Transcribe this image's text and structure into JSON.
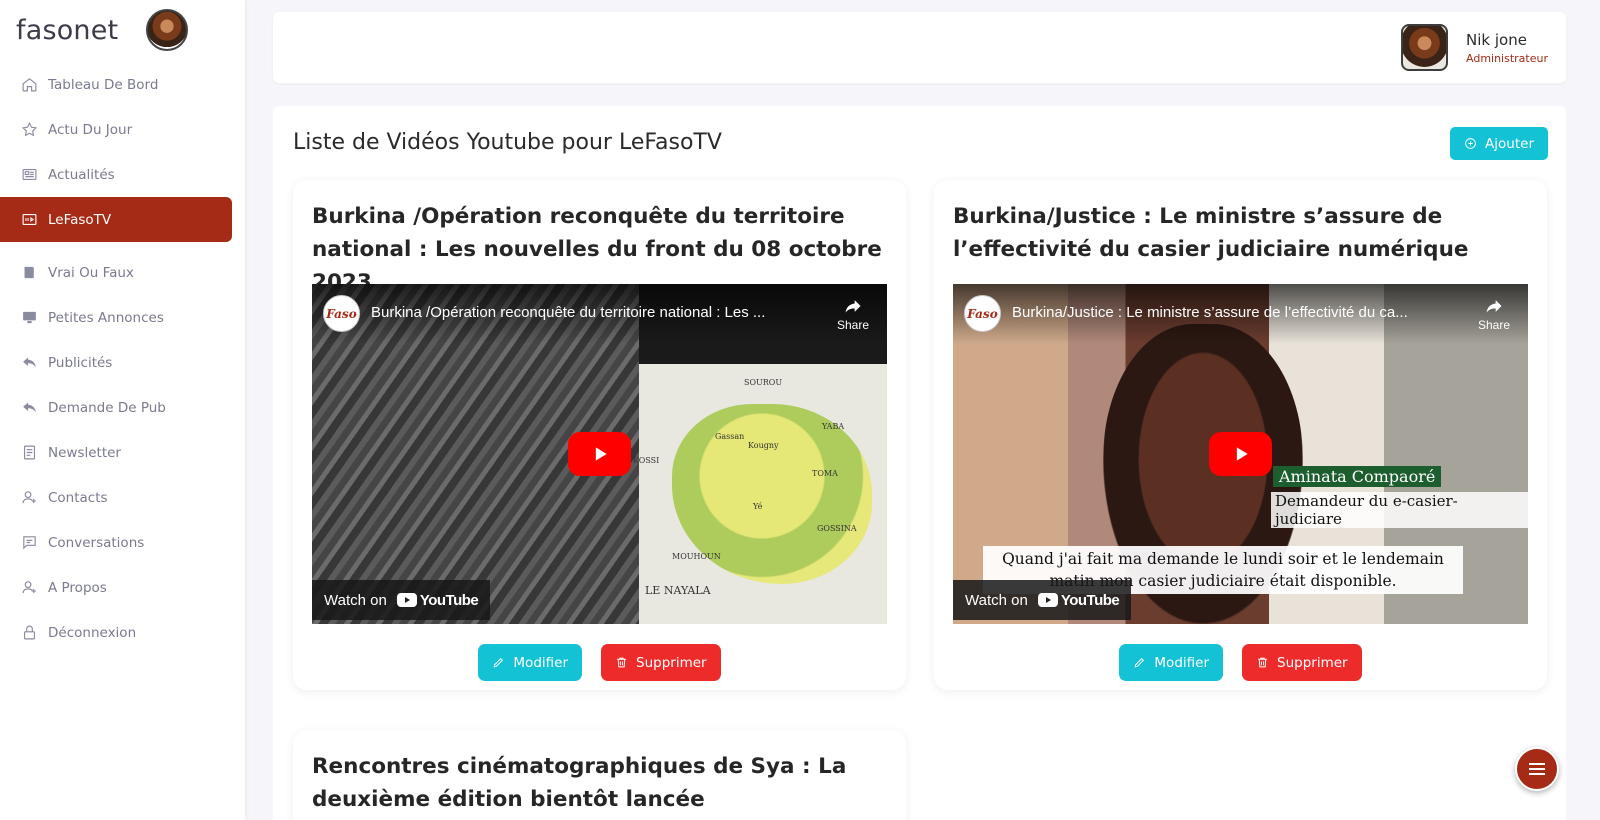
{
  "app": {
    "brand": "fasonet"
  },
  "sidebar": {
    "items": [
      {
        "label": "Tableau De Bord",
        "icon": "home-icon",
        "active": false
      },
      {
        "label": "Actu Du Jour",
        "icon": "star-icon",
        "active": false
      },
      {
        "label": "Actualités",
        "icon": "newspaper-icon",
        "active": false
      },
      {
        "label": "LeFasoTV",
        "icon": "video-icon",
        "active": true
      },
      {
        "label": "Vrai Ou Faux",
        "icon": "book-icon",
        "active": false
      },
      {
        "label": "Petites Annonces",
        "icon": "monitor-icon",
        "active": false
      },
      {
        "label": "Publicités",
        "icon": "reply-icon",
        "active": false
      },
      {
        "label": "Demande De Pub",
        "icon": "reply-icon",
        "active": false
      },
      {
        "label": "Newsletter",
        "icon": "document-icon",
        "active": false
      },
      {
        "label": "Contacts",
        "icon": "user-plus-icon",
        "active": false
      },
      {
        "label": "Conversations",
        "icon": "chat-icon",
        "active": false
      },
      {
        "label": "A Propos",
        "icon": "user-plus-icon",
        "active": false
      },
      {
        "label": "Déconnexion",
        "icon": "lock-icon",
        "active": false
      }
    ]
  },
  "header": {
    "user_name": "Nik jone",
    "user_role": "Administrateur"
  },
  "main": {
    "title": "Liste de Vidéos Youtube pour LeFasoTV",
    "add_label": "Ajouter",
    "videos": [
      {
        "title": "Burkina /Opération reconquête du territoire national : Les nouvelles du front du 08 octobre 2023",
        "player_title": "Burkina /Opération reconquête du territoire national : Les ...",
        "edit_label": "Modifier",
        "delete_label": "Supprimer"
      },
      {
        "title": "Burkina/Justice : Le ministre s’assure de l’effectivité du casier judiciaire numérique",
        "player_title": "Burkina/Justice : Le ministre s’assure de l’effectivité du ca...",
        "caption_name": "Aminata Compaoré",
        "caption_role": "Demandeur du e-casier-judiciare",
        "caption_sub": "Quand j'ai fait ma demande le lundi soir et le lendemain matin mon casier judiciaire était disponible.",
        "edit_label": "Modifier",
        "delete_label": "Supprimer"
      },
      {
        "title": "Rencontres cinématographiques de Sya : La deuxième édition bientôt lancée"
      }
    ],
    "player": {
      "share_label": "Share",
      "watch_on": "Watch on",
      "youtube": "YouTube",
      "channel_logo_text": "Faso"
    },
    "map_labels": [
      "SOUROU",
      "KOSSI",
      "Gassan",
      "Kougny",
      "TOMA",
      "Yé",
      "GOSSINA",
      "MOUHOUN",
      "LE NAYALA",
      "YABA"
    ]
  },
  "colors": {
    "accent": "#a52b17",
    "info": "#14c2d6",
    "danger": "#ee2b2b"
  }
}
